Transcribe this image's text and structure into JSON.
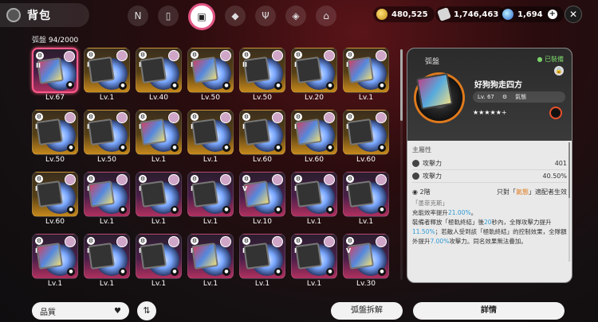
{
  "header": {
    "title": "背包",
    "tabs": [
      "N",
      "phone",
      "disc",
      "box",
      "food",
      "cube",
      "home"
    ],
    "active_tab": 2
  },
  "currencies": [
    {
      "icon": "gold-coin-icon",
      "value": "480,525"
    },
    {
      "icon": "ticket-icon",
      "value": "1,746,463"
    },
    {
      "icon": "gem-icon",
      "value": "1,694"
    }
  ],
  "inventory": {
    "label": "弧盤",
    "count": "94/2000",
    "items": [
      {
        "lv": "Lv.67",
        "rarity": "purple",
        "rank": "II",
        "selected": true
      },
      {
        "lv": "Lv.1",
        "rarity": "gold",
        "rank": "I"
      },
      {
        "lv": "Lv.40",
        "rarity": "gold",
        "rank": "I"
      },
      {
        "lv": "Lv.50",
        "rarity": "gold",
        "rank": "I"
      },
      {
        "lv": "Lv.50",
        "rarity": "gold",
        "rank": "II"
      },
      {
        "lv": "Lv.20",
        "rarity": "gold",
        "rank": "I"
      },
      {
        "lv": "Lv.1",
        "rarity": "gold",
        "rank": "I"
      },
      {
        "lv": "Lv.50",
        "rarity": "gold",
        "rank": "I"
      },
      {
        "lv": "Lv.50",
        "rarity": "gold",
        "rank": "I"
      },
      {
        "lv": "Lv.1",
        "rarity": "gold",
        "rank": "I"
      },
      {
        "lv": "Lv.1",
        "rarity": "gold",
        "rank": "I"
      },
      {
        "lv": "Lv.60",
        "rarity": "gold",
        "rank": "I"
      },
      {
        "lv": "Lv.60",
        "rarity": "gold",
        "rank": "I"
      },
      {
        "lv": "Lv.60",
        "rarity": "gold",
        "rank": "I"
      },
      {
        "lv": "Lv.60",
        "rarity": "gold",
        "rank": "I"
      },
      {
        "lv": "Lv.1",
        "rarity": "purple",
        "rank": "I"
      },
      {
        "lv": "Lv.1",
        "rarity": "purple",
        "rank": "I"
      },
      {
        "lv": "Lv.1",
        "rarity": "purple",
        "rank": "I"
      },
      {
        "lv": "Lv.10",
        "rarity": "purple",
        "rank": "V"
      },
      {
        "lv": "Lv.1",
        "rarity": "purple",
        "rank": "I"
      },
      {
        "lv": "Lv.1",
        "rarity": "purple",
        "rank": "I"
      },
      {
        "lv": "Lv.1",
        "rarity": "purple",
        "rank": "I"
      },
      {
        "lv": "Lv.1",
        "rarity": "purple",
        "rank": "I"
      },
      {
        "lv": "Lv.1",
        "rarity": "purple",
        "rank": "I"
      },
      {
        "lv": "Lv.1",
        "rarity": "purple",
        "rank": "I"
      },
      {
        "lv": "Lv.1",
        "rarity": "purple",
        "rank": "I"
      },
      {
        "lv": "Lv.1",
        "rarity": "purple",
        "rank": "I"
      },
      {
        "lv": "Lv.30",
        "rarity": "purple",
        "rank": "V"
      }
    ]
  },
  "controls": {
    "sort_label": "品質",
    "dismantle_label": "弧盤拆解",
    "detail_label": "詳情"
  },
  "detail": {
    "category": "弧盤",
    "equipped": "● 已裝備",
    "name": "好狗狗走四方",
    "level": "Lv. 67",
    "tag": "氣態",
    "stars": "★★★★★+",
    "stats_header": "主屬性",
    "stats": [
      {
        "label": "攻擊力",
        "value": "401"
      },
      {
        "label": "攻擊力",
        "value": "40.50%"
      }
    ],
    "skill_level": "2階",
    "skill_note_prefix": "只對「",
    "skill_note_hl": "氣態",
    "skill_note_suffix": "」適配者生效",
    "skill_name": "「墨菲克斯」",
    "desc_1a": "充能效率提升",
    "desc_1b": "21.00%",
    "desc_1c": "。",
    "desc_2a": "裝備者釋放「極軌終結」後",
    "desc_2b": "20",
    "desc_2c": "秒內，全隊攻擊力提升",
    "desc_2d": "11.50%",
    "desc_2e": "；若敵人受到該「極軌終結」的控制效果，全隊額外提升",
    "desc_2f": "7.00%",
    "desc_2g": "攻擊力。同名效果無法疊加。"
  }
}
